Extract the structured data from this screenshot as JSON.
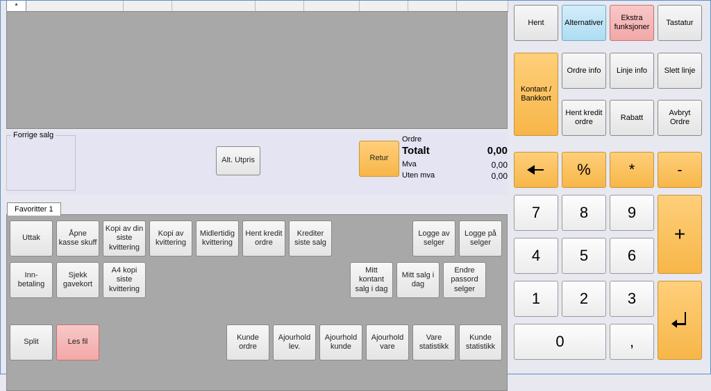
{
  "grid": {
    "row_marker": "*"
  },
  "mid": {
    "forrige_salg_label": "Forrige salg",
    "alt_utpris": "Alt. Utpris",
    "retur": "Retur"
  },
  "totals": {
    "ordre_label": "Ordre",
    "total_label": "Totalt",
    "total_value": "0,00",
    "mva_label": "Mva",
    "mva_value": "0,00",
    "uten_mva_label": "Uten mva",
    "uten_mva_value": "0,00"
  },
  "fav": {
    "tab": "Favoritter 1",
    "r1": {
      "uttak": "Uttak",
      "apne_kasse": "Åpne kasse skuff",
      "kopi_din_siste": "Kopi av din siste kvittering",
      "kopi_av_kvittering": "Kopi av kvittering",
      "midlertidig": "Midlertidig kvittering",
      "hent_kredit_ordre": "Hent kredit ordre",
      "krediter_siste": "Krediter siste salg",
      "logge_av": "Logge av selger",
      "logge_pa": "Logge på selger"
    },
    "r2": {
      "innbetaling": "Inn-betaling",
      "sjekk_gavekort": "Sjekk gavekort",
      "a4_kopi": "A4 kopi siste kvittering",
      "mitt_kontant": "Mitt kontant salg i dag",
      "mitt_salg": "Mitt salg i dag",
      "endre_passord": "Endre passord selger"
    },
    "r3": {
      "split": "Split",
      "les_fil": "Les fil",
      "kunde_ordre": "Kunde ordre",
      "ajourhold_lev": "Ajourhold lev.",
      "ajourhold_kunde": "Ajourhold kunde",
      "ajourhold_vare": "Ajourhold vare",
      "vare_statistikk": "Vare statistikk",
      "kunde_statistikk": "Kunde statistikk"
    }
  },
  "right": {
    "hent": "Hent",
    "alternativer": "Alternativ­er",
    "ekstra": "Ekstra funksjoner",
    "tastatur": "Tastatur",
    "kontant": "Kontant / Bankkort",
    "ordre_info": "Ordre info",
    "linje_info": "Linje info",
    "slett_linje": "Slett linje",
    "hent_kredit": "Hent kredit ordre",
    "rabatt": "Rabatt",
    "avbryt": "Avbryt Ordre"
  },
  "keypad": {
    "percent": "%",
    "star": "*",
    "minus": "-",
    "plus": "+",
    "comma": ",",
    "k7": "7",
    "k8": "8",
    "k9": "9",
    "k4": "4",
    "k5": "5",
    "k6": "6",
    "k1": "1",
    "k2": "2",
    "k3": "3",
    "k0": "0"
  }
}
